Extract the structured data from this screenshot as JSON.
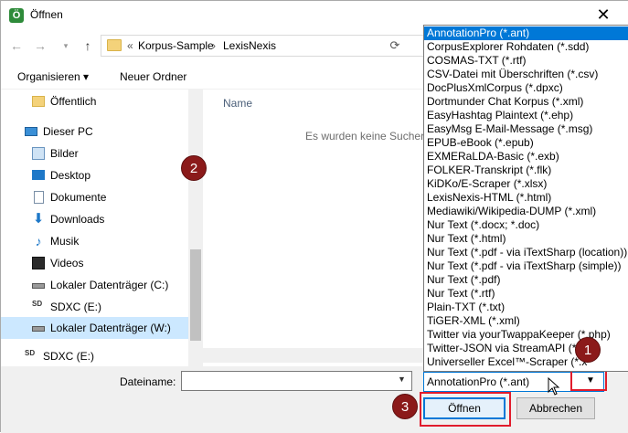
{
  "window": {
    "title": "Öffnen",
    "app_icon_glyph": "Ö",
    "close_glyph": "✕"
  },
  "address": {
    "crumbs": [
      "«",
      "Korpus-Sample",
      "›",
      "LexisNexis"
    ],
    "refresh_glyph": "⟳"
  },
  "toolbar": {
    "organize_label": "Organisieren ▾",
    "new_folder_label": "Neuer Ordner"
  },
  "nav": {
    "items": [
      {
        "label": "Öffentlich",
        "icon": "folder-icon"
      },
      {
        "label": "Dieser PC",
        "icon": "computer-icon"
      },
      {
        "label": "Bilder",
        "icon": "pictures-icon"
      },
      {
        "label": "Desktop",
        "icon": "desktop-icon"
      },
      {
        "label": "Dokumente",
        "icon": "documents-icon"
      },
      {
        "label": "Downloads",
        "icon": "downloads-icon"
      },
      {
        "label": "Musik",
        "icon": "music-icon"
      },
      {
        "label": "Videos",
        "icon": "videos-icon"
      },
      {
        "label": "Lokaler Datenträger (C:)",
        "icon": "drive-icon"
      },
      {
        "label": "SDXC (E:)",
        "icon": "sd-card-icon"
      },
      {
        "label": "Lokaler Datenträger (W:)",
        "icon": "drive-icon"
      },
      {
        "label": "SDXC (E:)",
        "icon": "sd-card-icon"
      }
    ]
  },
  "content": {
    "column_name": "Name",
    "empty_message": "Es wurden keine Sucherg"
  },
  "bottom": {
    "filename_label": "Dateiname:",
    "filename_value": "",
    "filter_value": "AnnotationPro (*.ant)",
    "open_label": "Öffnen",
    "cancel_label": "Abbrechen"
  },
  "dropdown": {
    "options": [
      "AnnotationPro (*.ant)",
      "CorpusExplorer Rohdaten (*.sdd)",
      "COSMAS-TXT (*.rtf)",
      "CSV-Datei mit Überschriften (*.csv)",
      "DocPlusXmlCorpus (*.dpxc)",
      "Dortmunder Chat Korpus (*.xml)",
      "EasyHashtag Plaintext (*.ehp)",
      "EasyMsg E-Mail-Message (*.msg)",
      "EPUB-eBook (*.epub)",
      "EXMERaLDA-Basic (*.exb)",
      "FOLKER-Transkript (*.flk)",
      "KiDKo/E-Scraper (*.xlsx)",
      "LexisNexis-HTML (*.html)",
      "Mediawiki/Wikipedia-DUMP (*.xml)",
      "Nur Text (*.docx; *.doc)",
      "Nur Text (*.html)",
      "Nur Text (*.pdf - via iTextSharp (location))",
      "Nur Text (*.pdf - via iTextSharp (simple))",
      "Nur Text (*.pdf)",
      "Nur Text (*.rtf)",
      "Plain-TXT (*.txt)",
      "TiGER-XML (*.xml)",
      "Twitter via yourTwappaKeeper (*.php)",
      "Twitter-JSON via StreamAPI (*.j",
      "Universeller Excel™-Scraper (*.x"
    ],
    "selected_index": 0
  },
  "markers": {
    "m1": "1",
    "m2": "2",
    "m3": "3"
  },
  "colors": {
    "accent": "#0078d7",
    "highlight_red": "#e11c2c",
    "marker": "#8b1a1a"
  }
}
